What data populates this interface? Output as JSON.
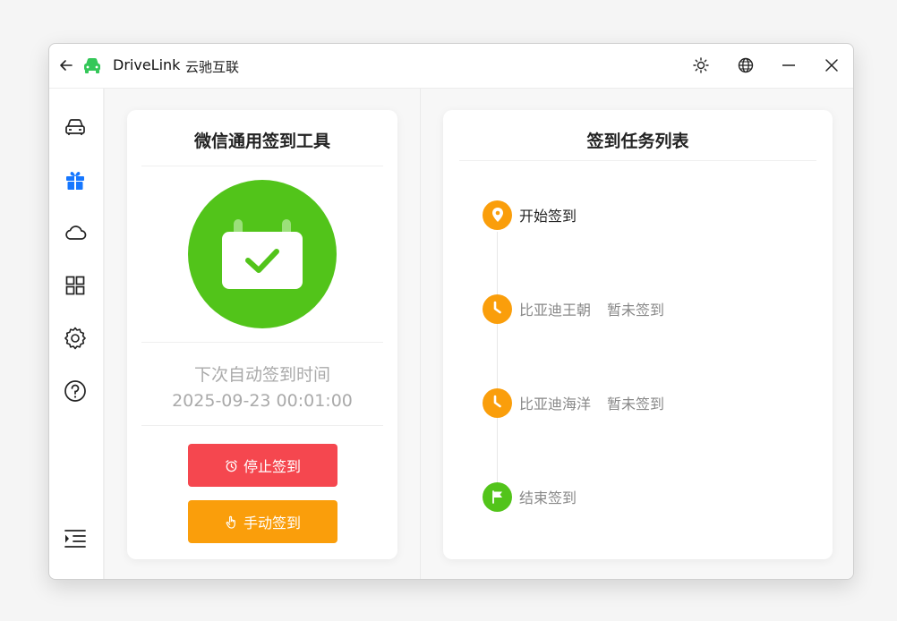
{
  "app": {
    "title": "DriveLink",
    "subtitle": "云驰互联"
  },
  "colors": {
    "accent_green": "#52c41a",
    "stop_red": "#f5474f",
    "manual_orange": "#fa9e0b",
    "timeline_orange": "#fa9e0b",
    "active_blue": "#1677ff"
  },
  "sidebar": {
    "items": [
      {
        "icon": "car-icon",
        "active": false
      },
      {
        "icon": "gift-icon",
        "active": true
      },
      {
        "icon": "cloud-icon",
        "active": false
      },
      {
        "icon": "apps-grid-icon",
        "active": false
      },
      {
        "icon": "gear-icon",
        "active": false
      },
      {
        "icon": "help-icon",
        "active": false
      }
    ],
    "bottom_icon": "menu-collapse-icon"
  },
  "left_card": {
    "title": "微信通用签到工具",
    "next_label": "下次自动签到时间",
    "next_time": "2025-09-23 00:01:00",
    "stop_button": "停止签到",
    "manual_button": "手动签到"
  },
  "right_card": {
    "title": "签到任务列表",
    "tasks": [
      {
        "label": "开始签到",
        "status": "",
        "icon": "location-pin-icon"
      },
      {
        "label": "比亚迪王朝",
        "status": "暂未签到",
        "icon": "clock-icon"
      },
      {
        "label": "比亚迪海洋",
        "status": "暂未签到",
        "icon": "clock-icon"
      },
      {
        "label": "结束签到",
        "status": "",
        "icon": "flag-icon"
      }
    ]
  }
}
